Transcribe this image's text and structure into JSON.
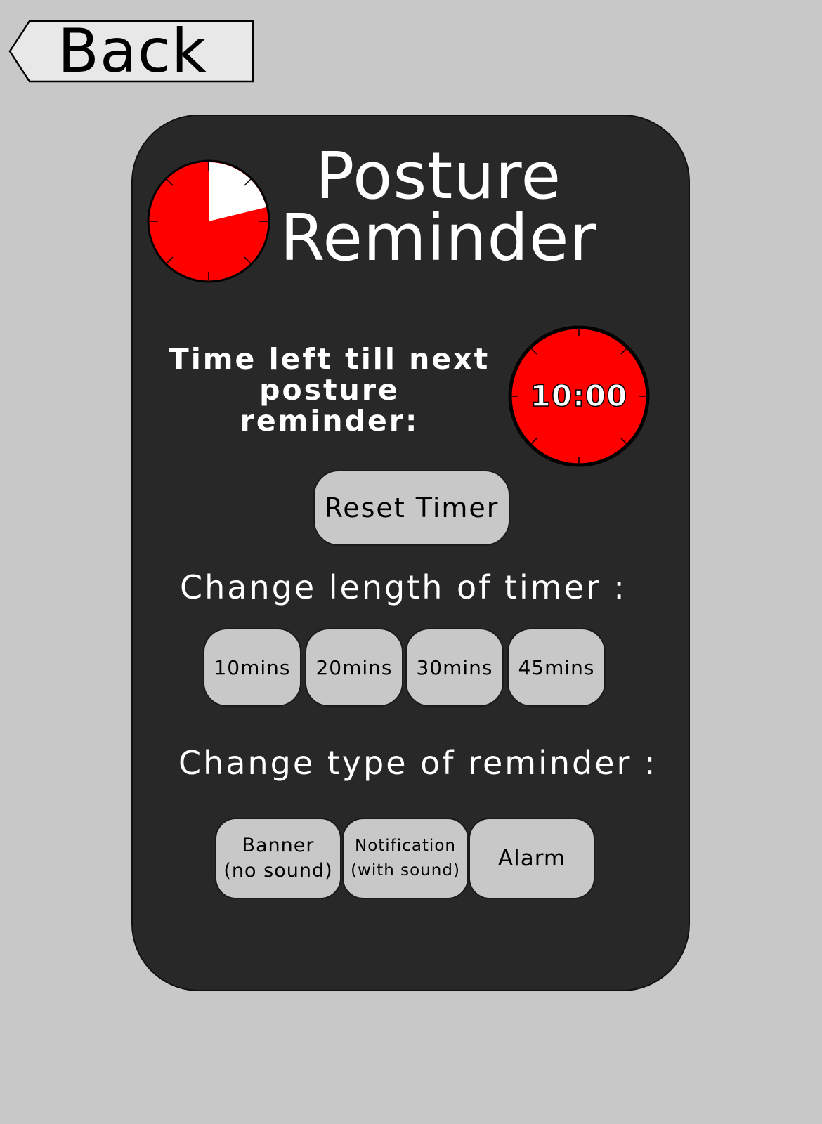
{
  "back": {
    "label": "Back"
  },
  "header": {
    "title_line1": "Posture",
    "title_line2": "Reminder"
  },
  "countdown": {
    "label_line1": "Time left till next",
    "label_line2": "posture reminder:",
    "value": "10:00"
  },
  "reset": {
    "label": "Reset Timer"
  },
  "timer_length": {
    "label": "Change length of timer :",
    "options": [
      "10mins",
      "20mins",
      "30mins",
      "45mins"
    ]
  },
  "reminder_type": {
    "label": "Change type of reminder :",
    "options": [
      {
        "line1": "Banner",
        "line2": "(no sound)"
      },
      {
        "line1": "Notification",
        "line2": "(with sound)"
      },
      {
        "line1": "Alarm",
        "line2": ""
      }
    ]
  },
  "colors": {
    "background": "#c8c8c8",
    "panel": "#282828",
    "clock_red": "#ff0000",
    "button": "#c8c8c8"
  },
  "icons": {
    "logo": "posture-clock-icon",
    "timer": "timer-clock-icon",
    "back": "back-arrow-icon"
  }
}
